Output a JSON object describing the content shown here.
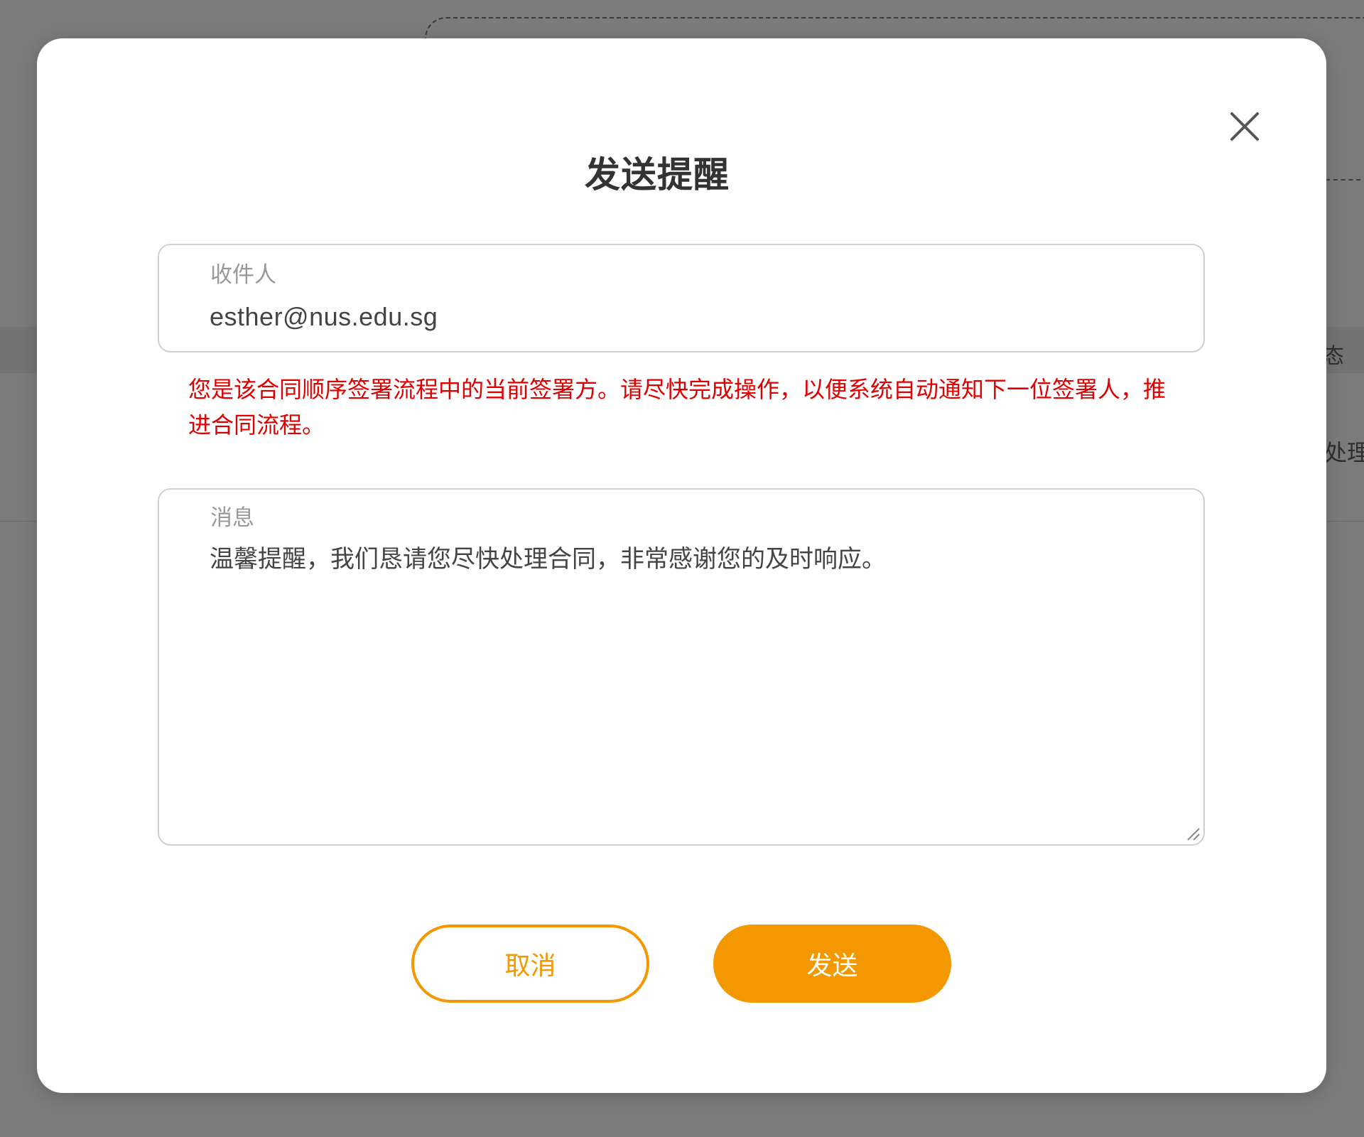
{
  "background": {
    "status_fragment": "态",
    "action_fragment": "处理"
  },
  "dialog": {
    "title": "发送提醒",
    "close_icon": "close-icon",
    "recipient": {
      "label": "收件人",
      "value": "esther@nus.edu.sg"
    },
    "warning": "您是该合同顺序签署流程中的当前签署方。请尽快完成操作，以便系统自动通知下一位签署人，推进合同流程。",
    "message": {
      "label": "消息",
      "value": "温馨提醒，我们恳请您尽快处理合同，非常感谢您的及时响应。"
    },
    "buttons": {
      "cancel_label": "取消",
      "send_label": "发送"
    }
  },
  "colors": {
    "accent": "#f39800",
    "warning": "#e00000",
    "overlay": "#7b7b7b"
  }
}
